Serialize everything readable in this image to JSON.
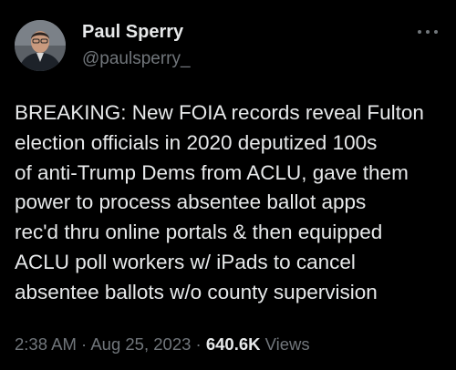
{
  "author": {
    "display_name": "Paul Sperry",
    "handle": "@paulsperry_",
    "avatar_icon": "profile-photo"
  },
  "menu": {
    "icon": "more-options-icon"
  },
  "tweet": {
    "lines": [
      "BREAKING: New FOIA records reveal Fulton",
      "election officials in 2020 deputized 100s",
      "of anti-Trump Dems from ACLU, gave them",
      "power to process absentee ballot apps",
      "rec'd thru online portals & then equipped",
      "ACLU poll workers w/ iPads to cancel",
      "absentee ballots w/o county supervision"
    ]
  },
  "meta": {
    "time": "2:38 AM",
    "separator": "·",
    "date": "Aug 25, 2023",
    "views_count": "640.6K",
    "views_label": "Views"
  },
  "colors": {
    "background": "#000000",
    "primary_text": "#e7e9ea",
    "secondary_text": "#71767b"
  }
}
